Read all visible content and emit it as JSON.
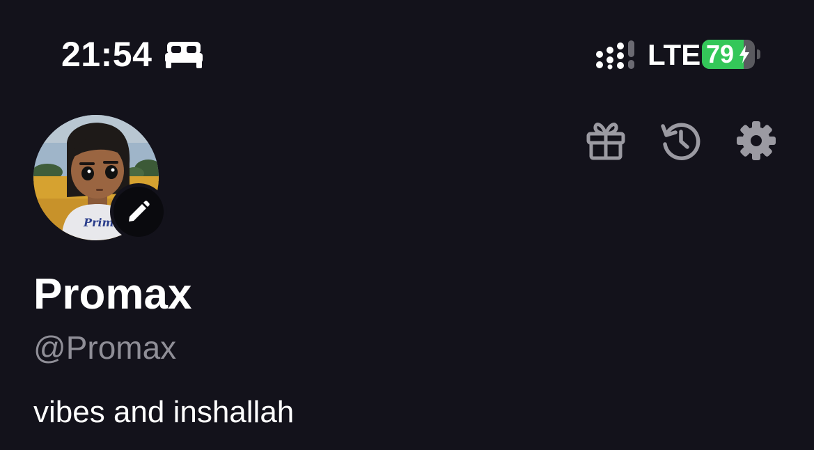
{
  "status_bar": {
    "time": "21:54",
    "focus_icon": "bed-icon",
    "signal_icon": "cellular-signal-icon",
    "network": "LTE",
    "battery_level": "79",
    "battery_percent": 79,
    "battery_charging": true,
    "battery_color": "#34c759"
  },
  "header": {
    "icons": [
      "gift-icon",
      "history-icon",
      "gear-icon"
    ]
  },
  "profile": {
    "avatar": "avatar",
    "edit_icon": "pencil-icon",
    "display_name": "Promax",
    "username": "@Promax",
    "bio": "vibes and inshallah"
  },
  "colors": {
    "background": "#13121b",
    "secondary_text": "#8f8e97",
    "icon_gray": "#9b9aa2"
  }
}
